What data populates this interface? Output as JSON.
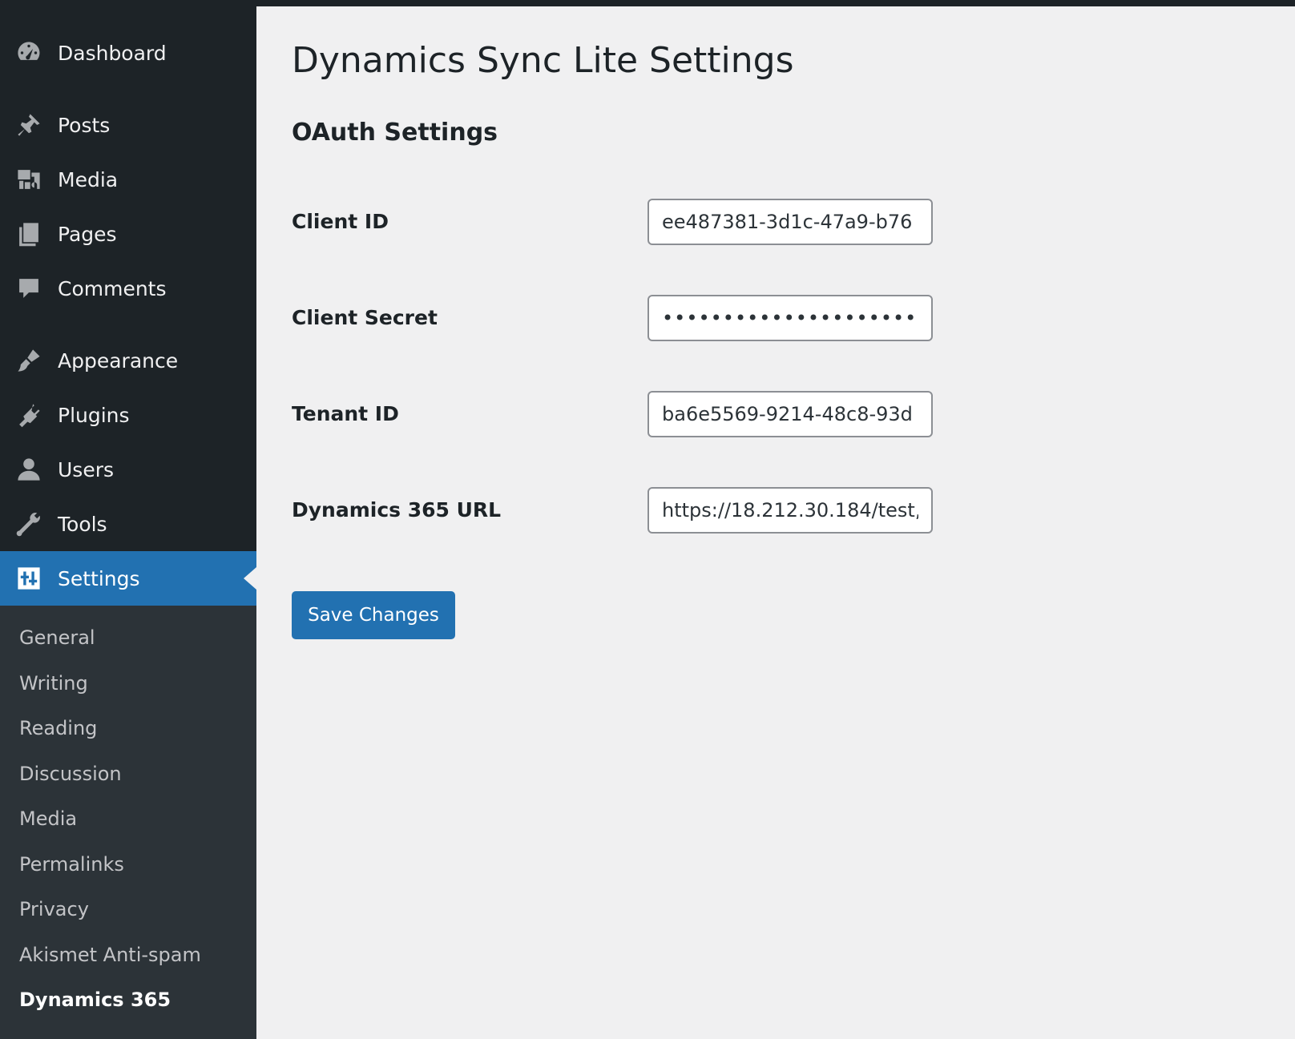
{
  "sidebar": {
    "items": [
      {
        "label": "Dashboard",
        "icon": "dashboard-icon"
      },
      {
        "label": "Posts",
        "icon": "pin-icon"
      },
      {
        "label": "Media",
        "icon": "media-icon"
      },
      {
        "label": "Pages",
        "icon": "pages-icon"
      },
      {
        "label": "Comments",
        "icon": "comment-icon"
      },
      {
        "label": "Appearance",
        "icon": "paintbrush-icon"
      },
      {
        "label": "Plugins",
        "icon": "plugin-icon"
      },
      {
        "label": "Users",
        "icon": "user-icon"
      },
      {
        "label": "Tools",
        "icon": "wrench-icon"
      },
      {
        "label": "Settings",
        "icon": "settings-icon"
      }
    ],
    "submenu": [
      {
        "label": "General"
      },
      {
        "label": "Writing"
      },
      {
        "label": "Reading"
      },
      {
        "label": "Discussion"
      },
      {
        "label": "Media"
      },
      {
        "label": "Permalinks"
      },
      {
        "label": "Privacy"
      },
      {
        "label": "Akismet Anti-spam"
      },
      {
        "label": "Dynamics 365"
      }
    ]
  },
  "page": {
    "title": "Dynamics Sync Lite Settings",
    "section_title": "OAuth Settings"
  },
  "form": {
    "client_id": {
      "label": "Client ID",
      "value": "ee487381-3d1c-47a9-b76"
    },
    "client_secret": {
      "label": "Client Secret",
      "value": "••••••••••••••••••••••••••••"
    },
    "tenant_id": {
      "label": "Tenant ID",
      "value": "ba6e5569-9214-48c8-93d"
    },
    "dynamics_url": {
      "label": "Dynamics 365 URL",
      "value": "https://18.212.30.184/test,"
    }
  },
  "actions": {
    "save_label": "Save Changes"
  },
  "colors": {
    "sidebar_bg": "#1d2327",
    "submenu_bg": "#2c3338",
    "accent": "#2271b1",
    "page_bg": "#f0f0f1"
  }
}
